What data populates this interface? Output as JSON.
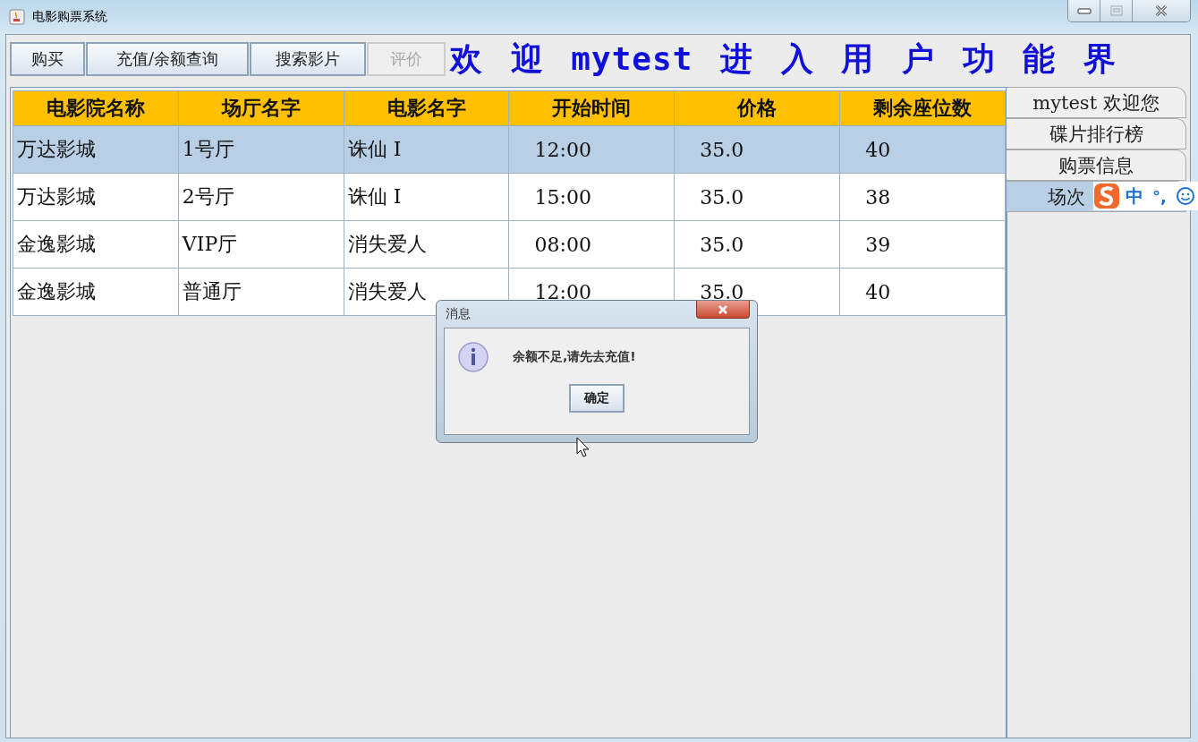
{
  "window": {
    "title": "电影购票系统"
  },
  "toolbar": {
    "buttons": [
      {
        "label": "购买",
        "disabled": false
      },
      {
        "label": "充值/余额查询",
        "disabled": false
      },
      {
        "label": "搜索影片",
        "disabled": false
      },
      {
        "label": "评价",
        "disabled": true
      }
    ],
    "heading": "欢 迎 mytest 进 入 用 户 功 能 界"
  },
  "table": {
    "columns": [
      "电影院名称",
      "场厅名字",
      "电影名字",
      "开始时间",
      "价格",
      "剩余座位数"
    ],
    "rows": [
      {
        "selected": true,
        "cells": [
          "万达影城",
          "1号厅",
          "诛仙 I",
          "12:00",
          "35.0",
          "40"
        ]
      },
      {
        "selected": false,
        "cells": [
          "万达影城",
          "2号厅",
          "诛仙 I",
          "15:00",
          "35.0",
          "38"
        ]
      },
      {
        "selected": false,
        "cells": [
          "金逸影城",
          "VIP厅",
          "消失爱人",
          "08:00",
          "35.0",
          "39"
        ]
      },
      {
        "selected": false,
        "cells": [
          "金逸影城",
          "普通厅",
          "消失爱人",
          "12:00",
          "35.0",
          "40"
        ]
      }
    ]
  },
  "side_tabs": [
    {
      "label": "mytest 欢迎您",
      "selected": false
    },
    {
      "label": "碟片排行榜",
      "selected": false
    },
    {
      "label": "购票信息",
      "selected": false
    },
    {
      "label": "场次",
      "selected": true
    }
  ],
  "ime_bar": {
    "mode": "中",
    "punctuation": "°,"
  },
  "dialog": {
    "title": "消息",
    "message": "余额不足,请先去充值!",
    "button": "确定"
  }
}
